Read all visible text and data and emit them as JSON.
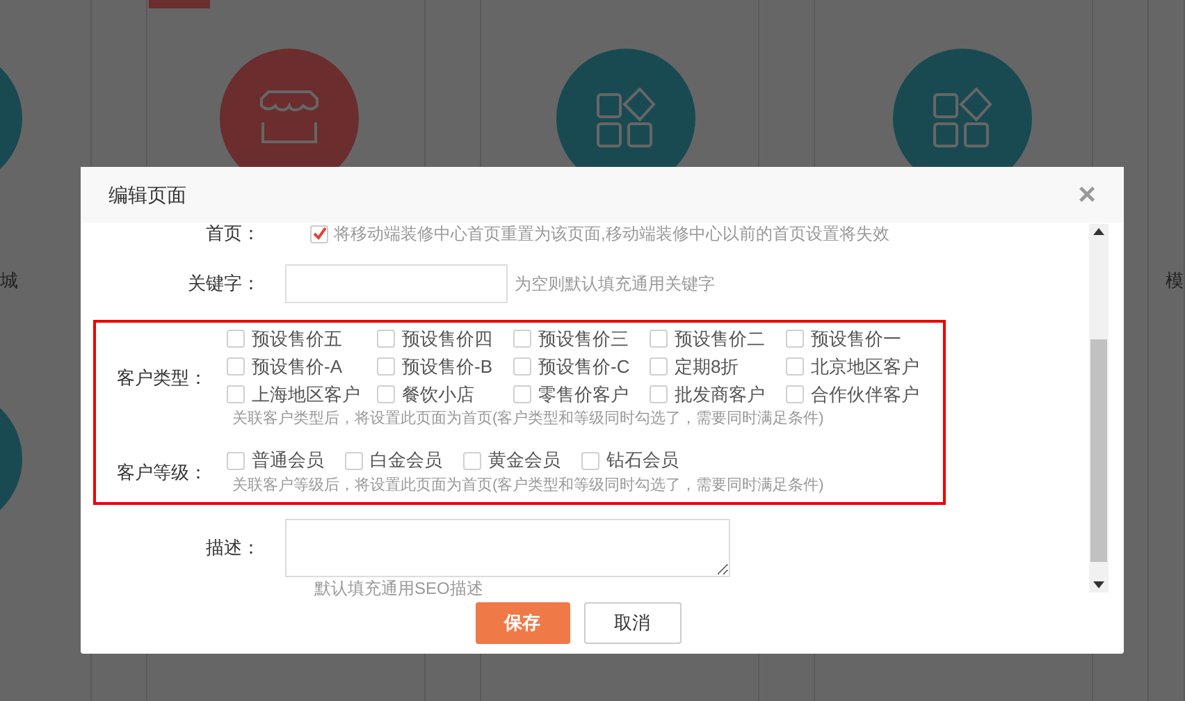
{
  "background": {
    "left_text": "城",
    "right_text": "模"
  },
  "dialog": {
    "title": "编辑页面",
    "close": "×",
    "home": {
      "label": "首页：",
      "checked": true,
      "text": "将移动端装修中心首页重置为该页面,移动端装修中心以前的首页设置将失效"
    },
    "keyword": {
      "label": "关键字：",
      "hint": "为空则默认填充通用关键字"
    },
    "customer_type": {
      "label": "客户类型：",
      "options": [
        {
          "label": "预设售价五",
          "checked": false
        },
        {
          "label": "预设售价四",
          "checked": false
        },
        {
          "label": "预设售价三",
          "checked": false
        },
        {
          "label": "预设售价二",
          "checked": false
        },
        {
          "label": "预设售价一",
          "checked": false
        },
        {
          "label": "预设售价-A",
          "checked": false
        },
        {
          "label": "预设售价-B",
          "checked": false
        },
        {
          "label": "预设售价-C",
          "checked": false
        },
        {
          "label": "定期8折",
          "checked": false
        },
        {
          "label": "北京地区客户",
          "checked": false
        },
        {
          "label": "上海地区客户",
          "checked": false
        },
        {
          "label": "餐饮小店",
          "checked": false
        },
        {
          "label": "零售价客户",
          "checked": false
        },
        {
          "label": "批发商客户",
          "checked": false
        },
        {
          "label": "合作伙伴客户",
          "checked": false
        }
      ],
      "hint": "关联客户类型后，将设置此页面为首页(客户类型和等级同时勾选了，需要同时满足条件)"
    },
    "customer_level": {
      "label": "客户等级：",
      "options": [
        {
          "label": "普通会员",
          "checked": false
        },
        {
          "label": "白金会员",
          "checked": false
        },
        {
          "label": "黄金会员",
          "checked": false
        },
        {
          "label": "钻石会员",
          "checked": false
        }
      ],
      "hint": "关联客户等级后，将设置此页面为首页(客户类型和等级同时勾选了，需要同时满足条件)"
    },
    "description": {
      "label": "描述：",
      "hint": "默认填充通用SEO描述"
    },
    "buttons": [
      {
        "label": "保存",
        "kind": "primary"
      },
      {
        "label": "取消",
        "kind": "secondary"
      }
    ]
  }
}
